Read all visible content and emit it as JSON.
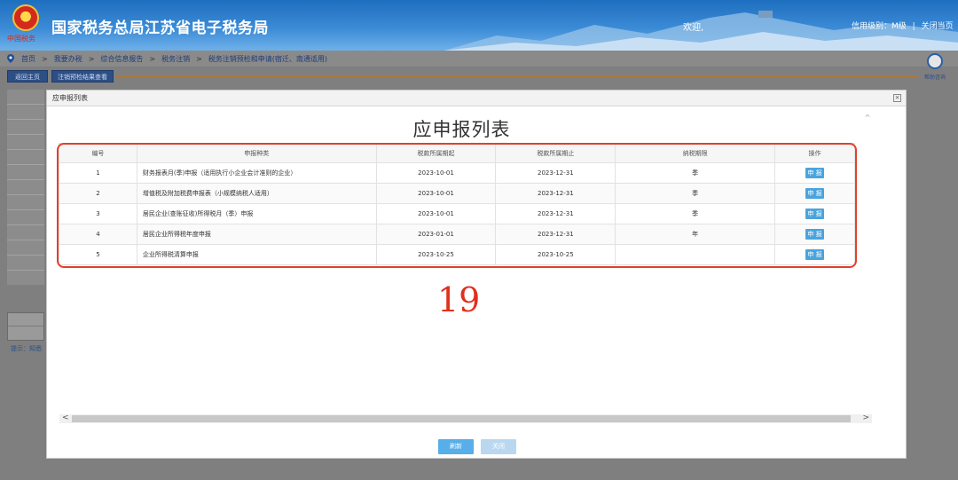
{
  "header": {
    "emblem_text": "中国税务",
    "site_title": "国家税务总局江苏省电子税务局",
    "welcome": "欢迎,",
    "credit_level": "信用级别：M级",
    "close_page": "关闭当页",
    "separator": "|"
  },
  "breadcrumb": {
    "items": [
      "首页",
      "我要办税",
      "综合信息报告",
      "税务注销",
      "税务注销预检和申请(宿迁、南通适用)"
    ],
    "separator": ">"
  },
  "toolbar": {
    "back_home": "返回主页",
    "progress_view": "注销预检结果查看"
  },
  "avatar": {
    "label": "帮助咨询"
  },
  "sidebar": {
    "hint": "提示：知悉"
  },
  "modal": {
    "header_title": "应申报列表",
    "close_x": "×",
    "title": "应申报列表",
    "columns": [
      "编号",
      "申报种类",
      "税款所属期起",
      "税款所属期止",
      "纳税期限",
      "操作"
    ],
    "rows": [
      {
        "no": "1",
        "type": "财务报表月(季)申报（适用执行小企业会计准则的企业）",
        "start": "2023-10-01",
        "end": "2023-12-31",
        "period": "季",
        "action": "申 报"
      },
      {
        "no": "2",
        "type": "增值税及附加税费申报表（小规模纳税人适用）",
        "start": "2023-10-01",
        "end": "2023-12-31",
        "period": "季",
        "action": "申 报"
      },
      {
        "no": "3",
        "type": "居民企业(查账征收)所得税月（季）申报",
        "start": "2023-10-01",
        "end": "2023-12-31",
        "period": "季",
        "action": "申 报"
      },
      {
        "no": "4",
        "type": "居民企业所得税年度申报",
        "start": "2023-01-01",
        "end": "2023-12-31",
        "period": "年",
        "action": "申 报"
      },
      {
        "no": "5",
        "type": "企业所得税清算申报",
        "start": "2023-10-25",
        "end": "2023-10-25",
        "period": "",
        "action": "申 报"
      }
    ],
    "annotation_number": "19",
    "refresh": "刷新",
    "close": "关闭"
  },
  "colors": {
    "header_blue": "#1f6fc0",
    "highlight_red": "#e3402a",
    "button_blue": "#4aa4dd"
  }
}
